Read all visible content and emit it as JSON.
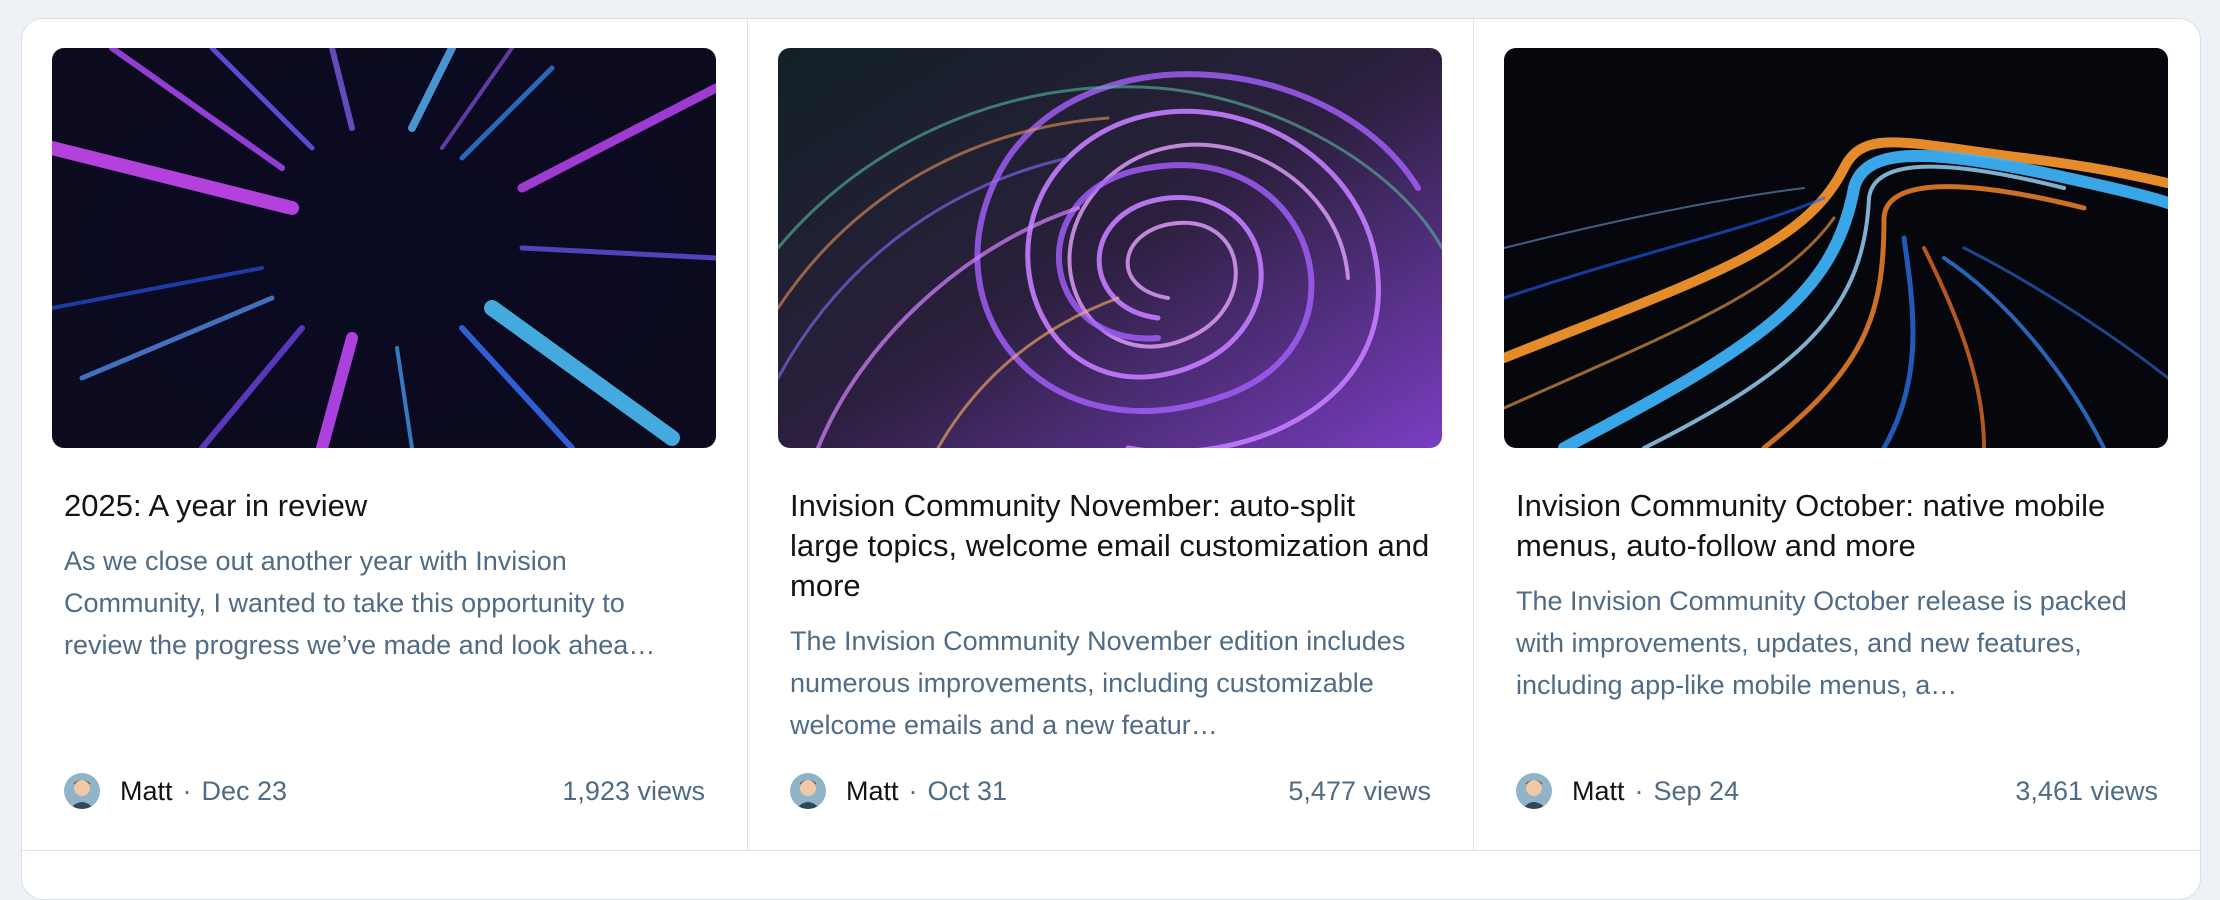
{
  "articles": [
    {
      "image": "purple-light-burst",
      "title": "2025: A year in review",
      "excerpt": "As we close out another year with Invision Community, I wanted to take this opportunity to review the progress we’ve made and look ahea…",
      "author": "Matt",
      "separator": "·",
      "date": "Dec 23",
      "views": "1,923 views"
    },
    {
      "image": "purple-swirl",
      "title": "Invision Community November: auto-split large topics, welcome email customization and more",
      "excerpt": "The Invision Community November edition includes numerous improvements, including customizable welcome emails and a new featur…",
      "author": "Matt",
      "separator": "·",
      "date": "Oct 31",
      "views": "5,477 views"
    },
    {
      "image": "light-trails-road",
      "title": "Invision Community October: native mobile menus, auto-follow and more",
      "excerpt": "The Invision Community October release is packed with improvements, updates, and new features, including app-like mobile menus, a…",
      "author": "Matt",
      "separator": "·",
      "date": "Sep 24",
      "views": "3,461 views"
    }
  ],
  "colors": {
    "title": "#121417",
    "muted": "#4f6b85",
    "border": "#dde2e8",
    "background": "#eef1f5"
  }
}
